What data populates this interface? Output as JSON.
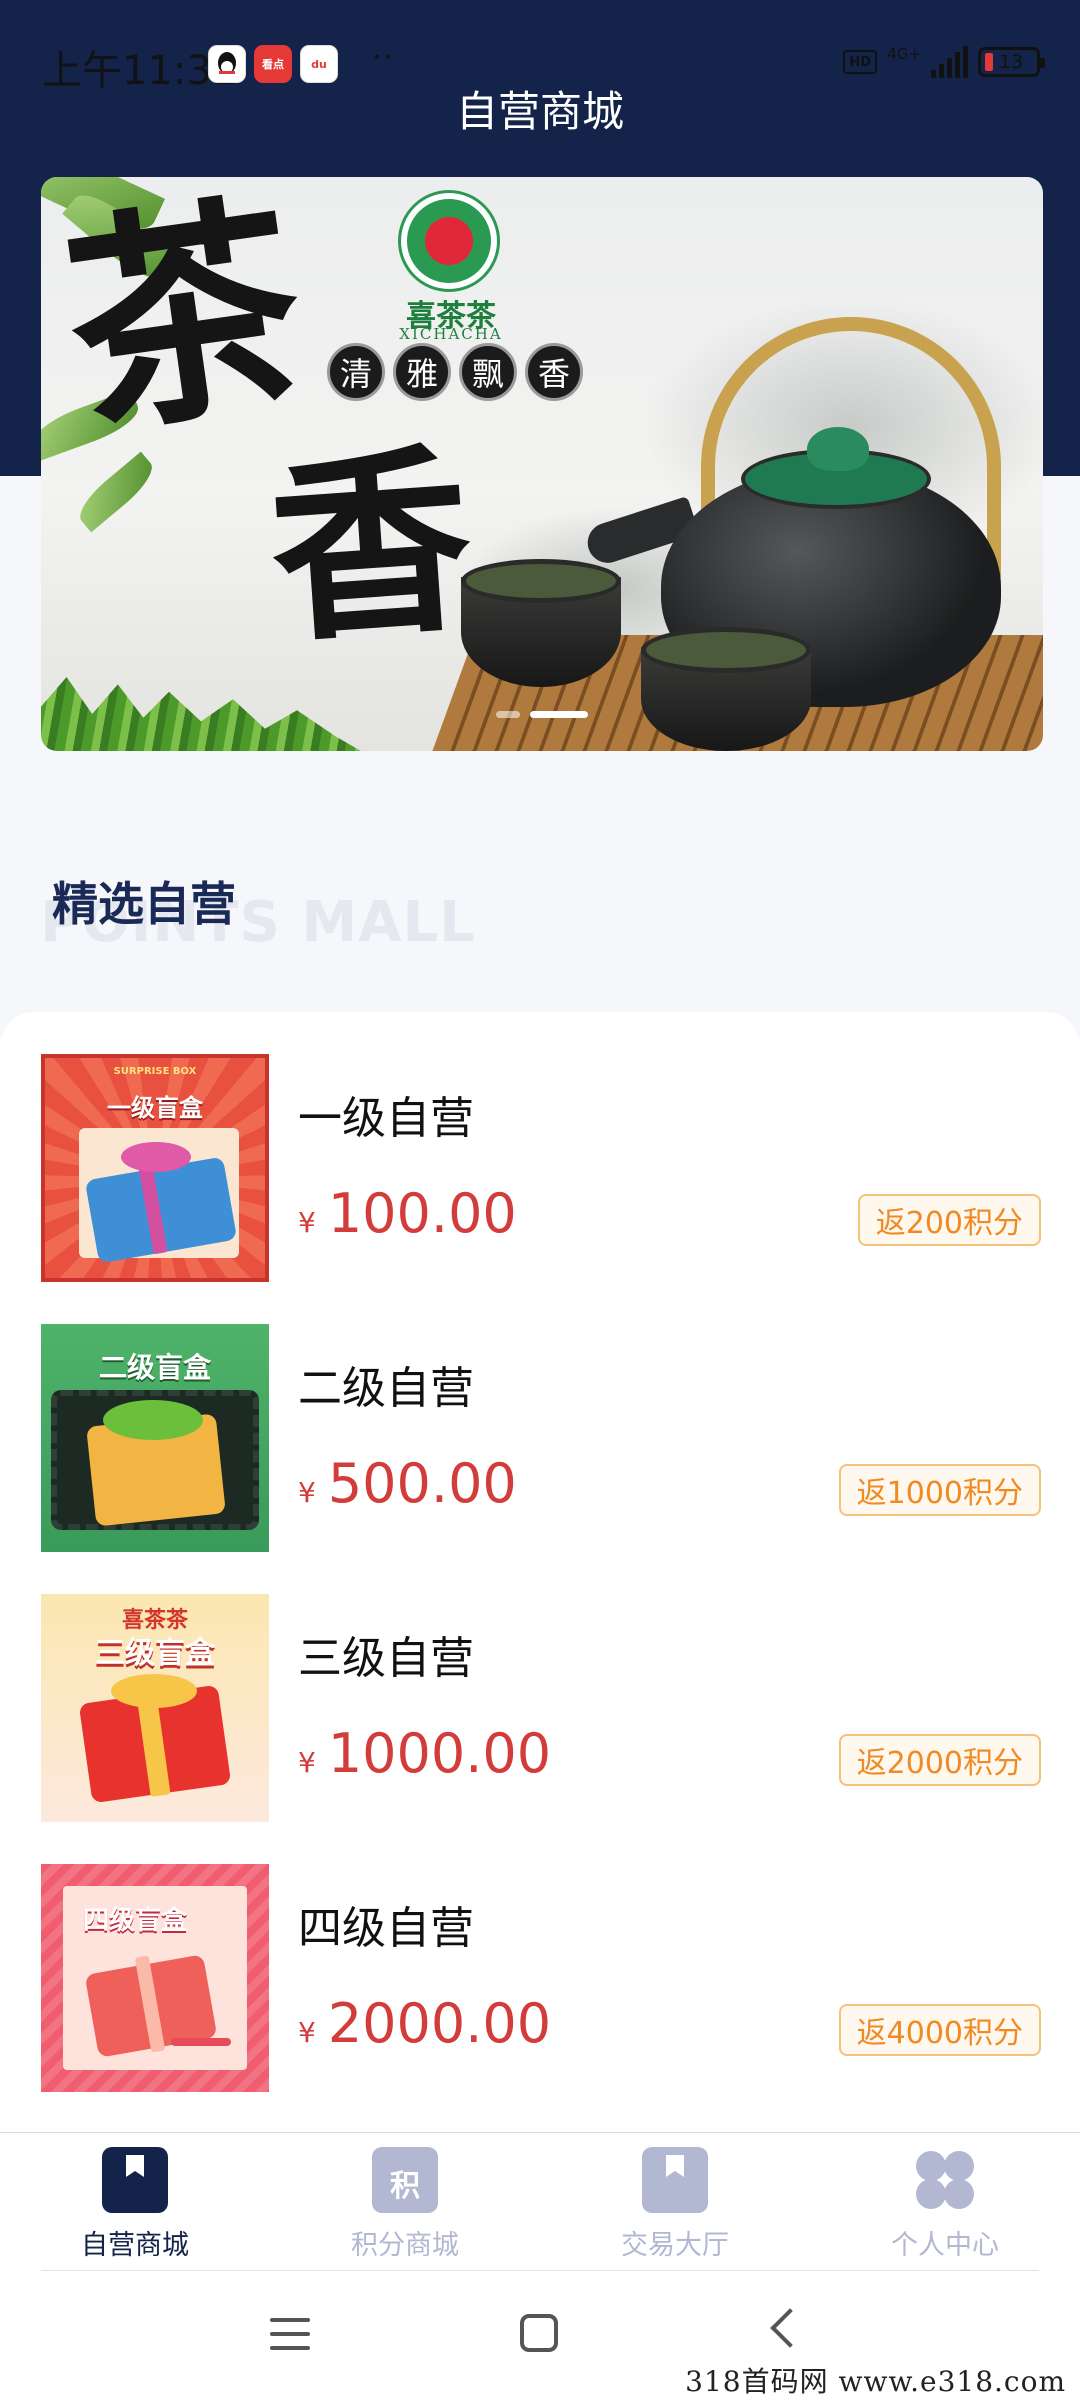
{
  "status_bar": {
    "time": "上午11:32",
    "apps": [
      "qq-icon",
      "看点",
      "du"
    ],
    "more": "··",
    "hd": "HD",
    "network": "4G+",
    "battery": "13"
  },
  "header": {
    "title": "自营商城"
  },
  "banner": {
    "brand_name": "喜茶茶",
    "brand_sub": "XICHACHA",
    "calligraphy": [
      "茶",
      "香"
    ],
    "slogan_chars": [
      "清",
      "雅",
      "飘",
      "香"
    ],
    "active_slide": 2,
    "slide_count": 2
  },
  "section": {
    "title": "精选自营",
    "ghost": "POINTS MALL"
  },
  "products": [
    {
      "name": "一级自营",
      "currency": "¥",
      "price": "100.00",
      "reward": "返200积分",
      "thumb_label": "一级盲盒",
      "thumb_top": "SURPRISE BOX"
    },
    {
      "name": "二级自营",
      "currency": "¥",
      "price": "500.00",
      "reward": "返1000积分",
      "thumb_label": "二级盲盒"
    },
    {
      "name": "三级自营",
      "currency": "¥",
      "price": "1000.00",
      "reward": "返2000积分",
      "thumb_label": "三级盲盒",
      "thumb_top": "喜茶茶"
    },
    {
      "name": "四级自营",
      "currency": "¥",
      "price": "2000.00",
      "reward": "返4000积分",
      "thumb_label": "四级盲盒"
    }
  ],
  "tabbar": {
    "tabs": [
      {
        "label": "自营商城",
        "icon": "store-icon",
        "active": true
      },
      {
        "label": "积分商城",
        "icon": "points-icon",
        "icon_char": "积",
        "active": false
      },
      {
        "label": "交易大厅",
        "icon": "trade-icon",
        "active": false
      },
      {
        "label": "个人中心",
        "icon": "profile-icon",
        "active": false
      }
    ]
  },
  "colors": {
    "header_bg": "#14234a",
    "active_tab": "#14234a",
    "inactive_tab": "#b3b8d2",
    "price": "#d23c3a",
    "badge": "#f08a24"
  },
  "watermark": "318首码网  www.e318.com"
}
